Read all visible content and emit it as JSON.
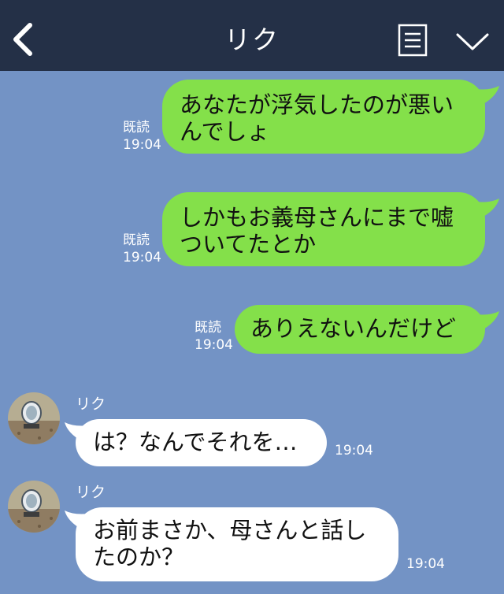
{
  "header": {
    "title": "リク",
    "back_icon": "chevron-left-icon",
    "menu_icon": "list-icon",
    "more_icon": "chevron-down-icon",
    "bg_color": "#243047"
  },
  "colors": {
    "background": "#7393c5",
    "sent_bubble": "#84e04a",
    "received_bubble": "#ffffff"
  },
  "messages": [
    {
      "direction": "sent",
      "line1": "あなたが浮気したのが悪い",
      "line2": "んでしょ",
      "read": "既読",
      "time": "19:04"
    },
    {
      "direction": "sent",
      "line1": "しかもお義母さんにまで嘘",
      "line2": "ついてたとか",
      "read": "既読",
      "time": "19:04"
    },
    {
      "direction": "sent",
      "line1": "ありえないんだけど",
      "read": "既読",
      "time": "19:04"
    },
    {
      "direction": "received",
      "sender": "リク",
      "line1": "は？なんでそれを…",
      "time": "19:04"
    },
    {
      "direction": "received",
      "sender": "リク",
      "line1": "お前まさか、母さんと話し",
      "line2": "たのか？",
      "time": "19:04"
    }
  ]
}
